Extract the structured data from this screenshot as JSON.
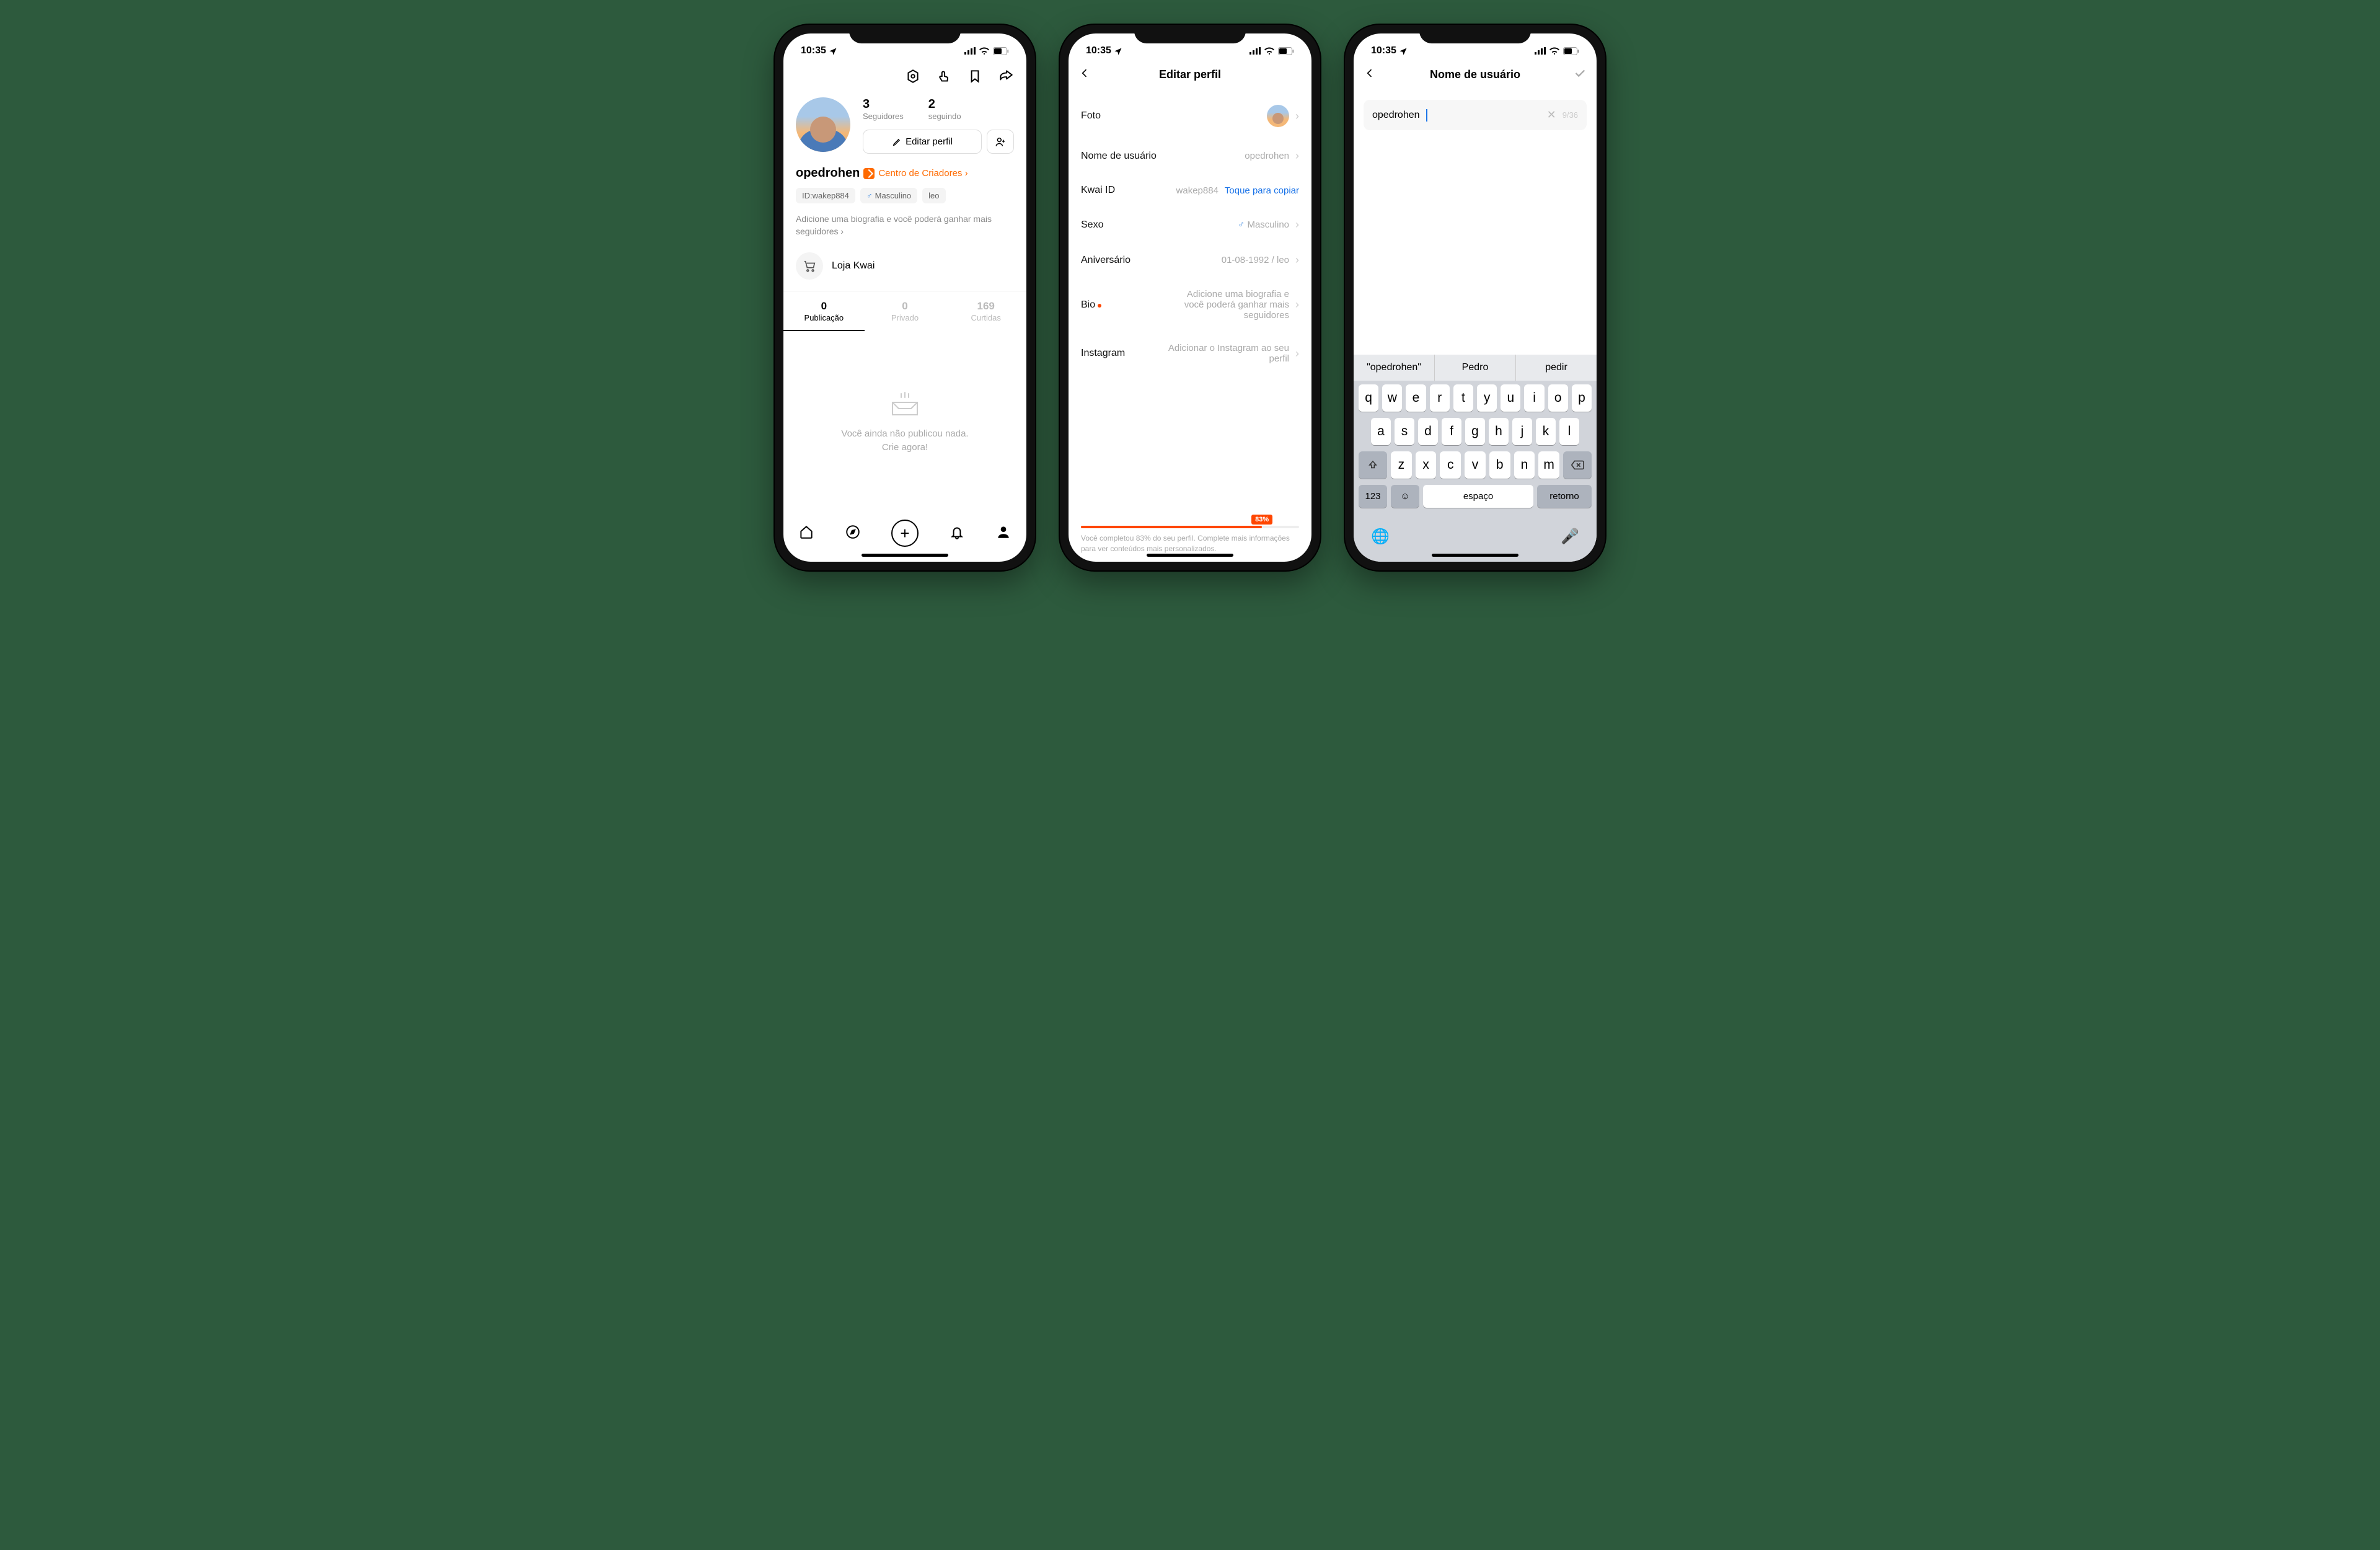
{
  "status": {
    "time": "10:35"
  },
  "phone1": {
    "stats": {
      "followers_num": "3",
      "followers_label": "Seguidores",
      "following_num": "2",
      "following_label": "seguindo"
    },
    "edit_label": "Editar perfil",
    "username": "opedrohen",
    "creator_center": "Centro de Criadores",
    "tags": {
      "id": "ID:wakep884",
      "gender": "Masculino",
      "sign": "leo"
    },
    "bio_hint": "Adicione uma biografia e você poderá ganhar mais seguidores",
    "shop": "Loja Kwai",
    "tabs": {
      "pub_num": "0",
      "pub_label": "Publicação",
      "priv_num": "0",
      "priv_label": "Privado",
      "likes_num": "169",
      "likes_label": "Curtidas"
    },
    "empty_l1": "Você ainda não publicou nada.",
    "empty_l2": "Crie agora!"
  },
  "phone2": {
    "title": "Editar perfil",
    "rows": {
      "photo": "Foto",
      "username_label": "Nome de usuário",
      "username_value": "opedrohen",
      "kwai_id_label": "Kwai ID",
      "kwai_id_value": "wakep884",
      "kwai_id_copy": "Toque para copiar",
      "gender_label": "Sexo",
      "gender_value": "Masculino",
      "birthday_label": "Aniversário",
      "birthday_value": "01-08-1992 / leo",
      "bio_label": "Bio",
      "bio_value": "Adicione uma biografia e você poderá ganhar mais seguidores",
      "instagram_label": "Instagram",
      "instagram_value": "Adicionar o Instagram ao seu perfil"
    },
    "progress": {
      "percent": "83%",
      "text": "Você completou 83% do  seu perfil. Complete mais informações para ver conteúdos mais personalizados."
    }
  },
  "phone3": {
    "title": "Nome de usuário",
    "input_value": "opedrohen",
    "char_count": "9/36",
    "suggestions": [
      "\"opedrohen\"",
      "Pedro",
      "pedir"
    ],
    "keys": {
      "r1": [
        "q",
        "w",
        "e",
        "r",
        "t",
        "y",
        "u",
        "i",
        "o",
        "p"
      ],
      "r2": [
        "a",
        "s",
        "d",
        "f",
        "g",
        "h",
        "j",
        "k",
        "l"
      ],
      "r3": [
        "z",
        "x",
        "c",
        "v",
        "b",
        "n",
        "m"
      ],
      "num": "123",
      "space": "espaço",
      "ret": "retorno"
    }
  }
}
